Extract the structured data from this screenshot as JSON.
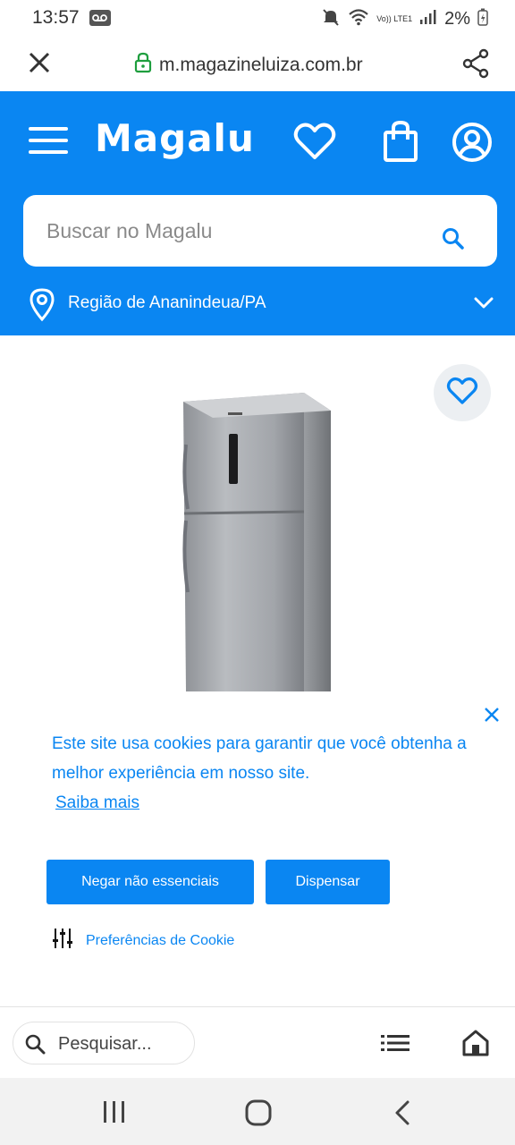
{
  "status_bar": {
    "time": "13:57",
    "network_label": "Vo)) LTE1",
    "battery": "2%"
  },
  "browser": {
    "url": "m.magazineluiza.com.br"
  },
  "header": {
    "logo": "Magalu",
    "search_placeholder": "Buscar no Magalu",
    "region": "Região de Ananindeua/PA"
  },
  "cookie_banner": {
    "message": "Este site usa cookies para garantir que você obtenha a melhor experiência em nosso site.",
    "learn_more": "Saiba mais",
    "deny_button": "Negar não essenciais",
    "dismiss_button": "Dispensar",
    "preferences": "Preferências de Cookie"
  },
  "bottom_toolbar": {
    "search_placeholder": "Pesquisar..."
  },
  "colors": {
    "brand_blue": "#0a86f2",
    "white": "#ffffff"
  }
}
